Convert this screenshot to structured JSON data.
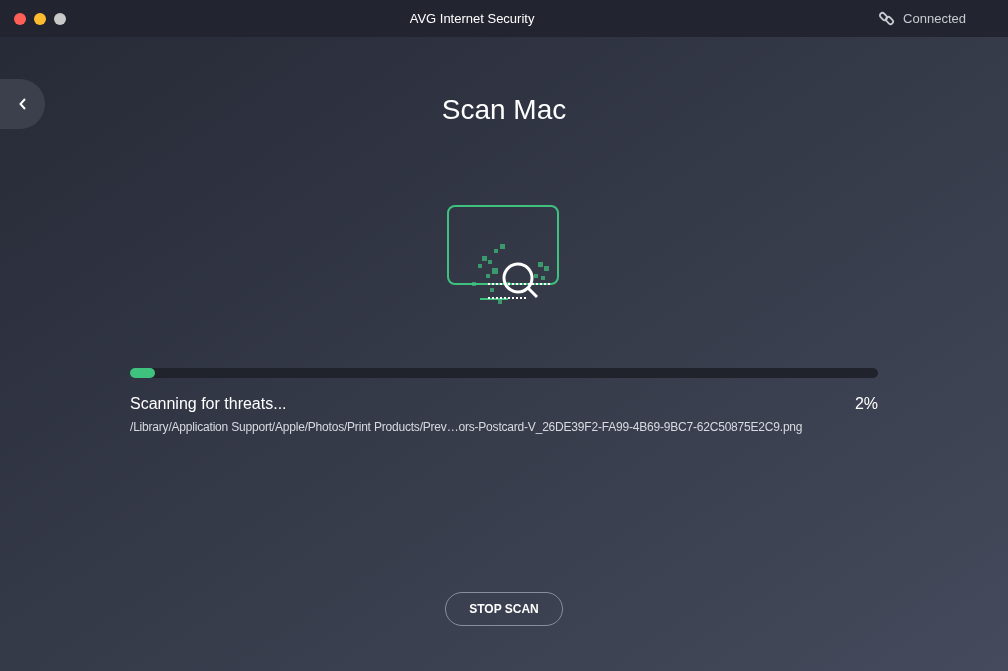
{
  "window": {
    "title": "AVG Internet Security"
  },
  "connection": {
    "label": "Connected"
  },
  "page": {
    "title": "Scan Mac"
  },
  "progress": {
    "level": 0.033,
    "status": "Scanning for threats...",
    "percent": "2%",
    "current_file": "/Library/Application Support/Apple/Photos/Print Products/Prev…ors-Postcard-V_26DE39F2-FA99-4B69-9BC7-62C50875E2C9.png"
  },
  "buttons": [
    "STOP SCAN"
  ]
}
